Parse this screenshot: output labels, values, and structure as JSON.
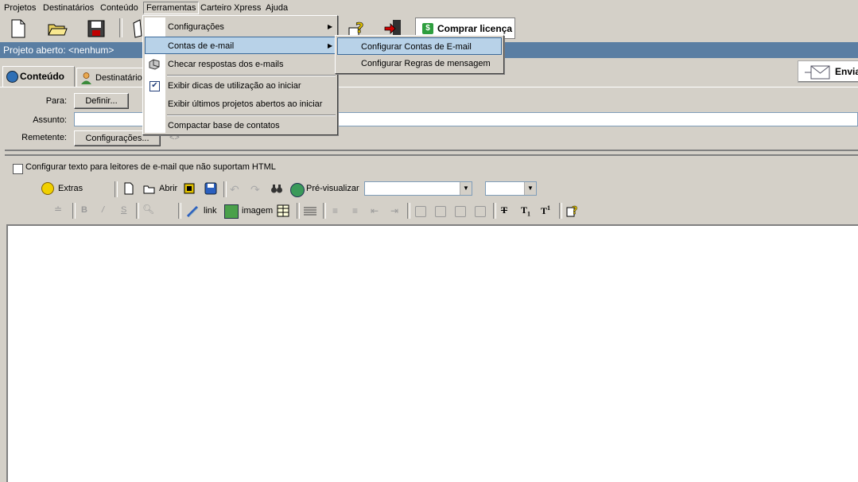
{
  "menubar": {
    "items": [
      "Projetos",
      "Destinatários",
      "Conteúdo",
      "Ferramentas",
      "Carteiro Xpress",
      "Ajuda"
    ]
  },
  "toolbar": {
    "buy_label": "Comprar licença"
  },
  "project_bar": {
    "text": "Projeto aberto: <nenhum>"
  },
  "tabs": [
    {
      "label": "Conteúdo"
    },
    {
      "label": "Destinatários"
    }
  ],
  "send_button": {
    "label": "Envia"
  },
  "form": {
    "to_label": "Para:",
    "to_button": "Definir...",
    "subject_label": "Assunto:",
    "sender_label": "Remetente:",
    "sender_button": "Configurações...",
    "sender_value": "<>"
  },
  "plain_text_checkbox": {
    "label": "Configurar texto para leitores de e-mail que não suportam HTML",
    "checked": false
  },
  "editor_toolbar": {
    "extras_label": "Extras",
    "open_label": "Abrir",
    "preview_label": "Pré-visualizar",
    "link_label": "link",
    "image_label": "imagem"
  },
  "ferramentas_menu": {
    "items": [
      {
        "label": "Configurações",
        "has_submenu": true
      },
      {
        "label": "Contas de e-mail",
        "has_submenu": true
      },
      {
        "label": "Checar respostas dos e-mails"
      },
      {
        "label": "Exibir dicas de utilização ao iniciar",
        "checked": true
      },
      {
        "label": "Exibir últimos projetos abertos ao iniciar"
      },
      {
        "label": "Compactar base de contatos"
      }
    ]
  },
  "email_submenu": {
    "items": [
      {
        "label": "Configurar Contas de E-mail"
      },
      {
        "label": "Configurar Regras de mensagem"
      }
    ]
  }
}
